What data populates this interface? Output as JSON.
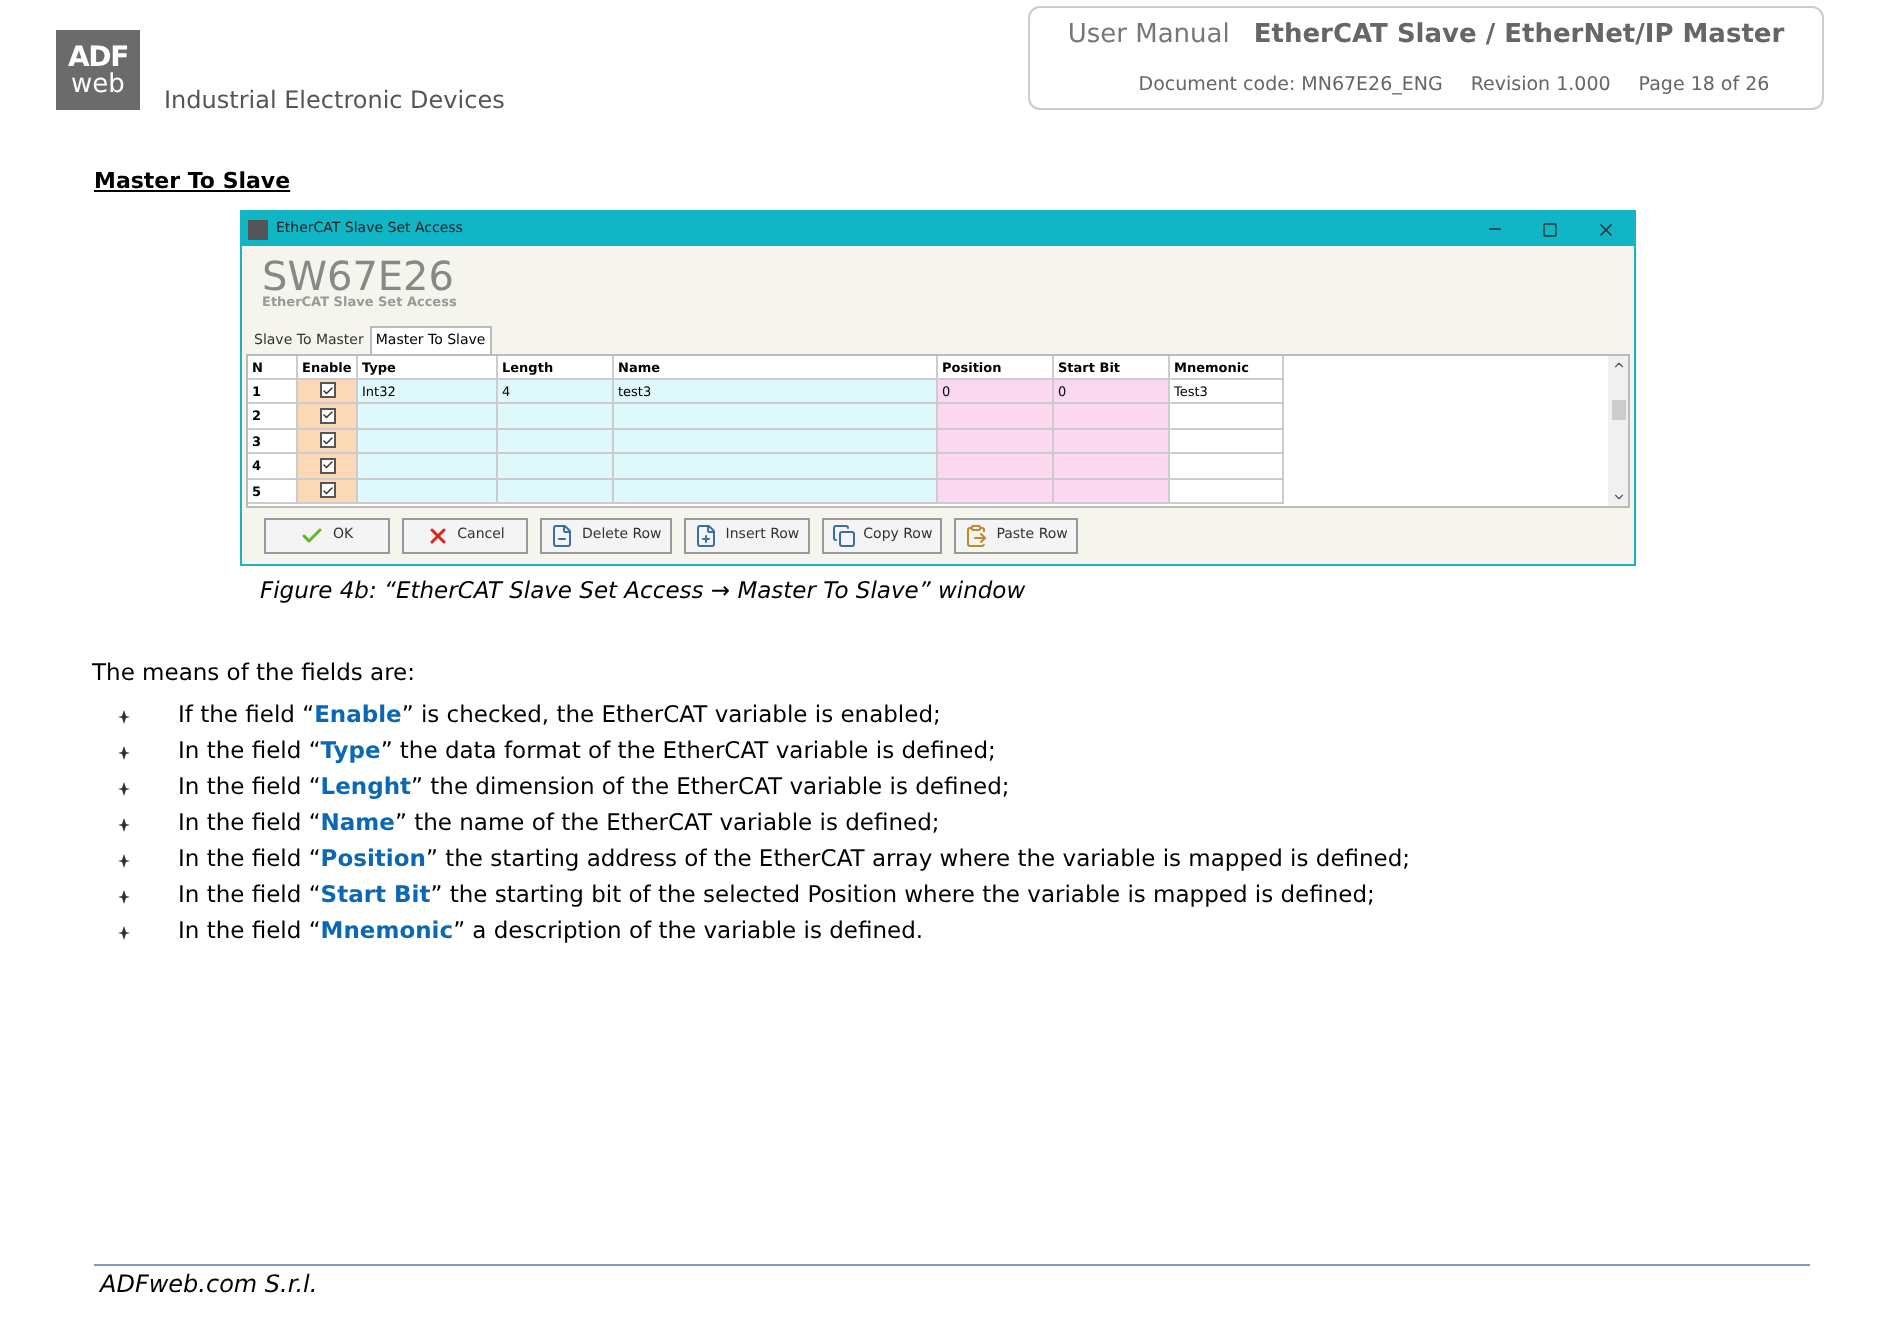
{
  "header": {
    "logo_top": "ADF",
    "logo_bottom": "web",
    "tagline": "Industrial Electronic Devices",
    "manual_label": "User Manual",
    "manual_title": "EtherCAT Slave / EtherNet/IP Master",
    "doc_code": "Document code: MN67E26_ENG",
    "revision": "Revision 1.000",
    "page": "Page 18 of 26"
  },
  "section_title": "Master To Slave",
  "window": {
    "title": "EtherCAT Slave Set Access",
    "app_name": "SW67E26",
    "app_subtitle": "EtherCAT Slave Set Access",
    "tabs": [
      {
        "label": "Slave To Master",
        "selected": false
      },
      {
        "label": "Master To Slave",
        "selected": true
      }
    ],
    "table": {
      "columns": [
        "N",
        "Enable",
        "Type",
        "Length",
        "Name",
        "Position",
        "Start Bit",
        "Mnemonic"
      ],
      "rows": [
        {
          "enabled": true,
          "cells": [
            "1",
            "",
            "Int32",
            "4",
            "test3",
            "0",
            "0",
            "Test3"
          ]
        },
        {
          "enabled": true,
          "cells": [
            "2",
            "",
            "",
            "",
            "",
            "",
            "",
            ""
          ]
        },
        {
          "enabled": true,
          "cells": [
            "3",
            "",
            "",
            "",
            "",
            "",
            "",
            ""
          ]
        },
        {
          "enabled": true,
          "cells": [
            "4",
            "",
            "",
            "",
            "",
            "",
            "",
            ""
          ]
        },
        {
          "enabled": true,
          "cells": [
            "5",
            "",
            "",
            "",
            "",
            "",
            "",
            ""
          ]
        }
      ]
    },
    "buttons": [
      {
        "kind": "ok",
        "label": "OK"
      },
      {
        "kind": "cancel",
        "label": "Cancel"
      },
      {
        "kind": "delete",
        "label": "Delete Row"
      },
      {
        "kind": "insert",
        "label": "Insert Row"
      },
      {
        "kind": "copy",
        "label": "Copy Row"
      },
      {
        "kind": "paste",
        "label": "Paste Row"
      }
    ]
  },
  "caption": "Figure 4b: “EtherCAT Slave Set Access → Master To Slave” window",
  "intro": "The means of the fields are:",
  "bullets": [
    "If the field “**Enable**” is checked, the EtherCAT variable is enabled;",
    "In the field “**Type**” the data format of the EtherCAT variable is defined;",
    "In the field “**Lenght**” the dimension of the EtherCAT variable is defined;",
    "In the field “**Name**” the name of the EtherCAT variable is defined;",
    "In the field “**Position**” the starting address of the EtherCAT array where the variable is mapped is defined;",
    "In the field “**Start Bit**” the starting bit of the selected Position where the variable is mapped is defined;",
    "In the field “**Mnemonic**” a description of the variable is defined."
  ],
  "footer": "ADFweb.com S.r.l."
}
